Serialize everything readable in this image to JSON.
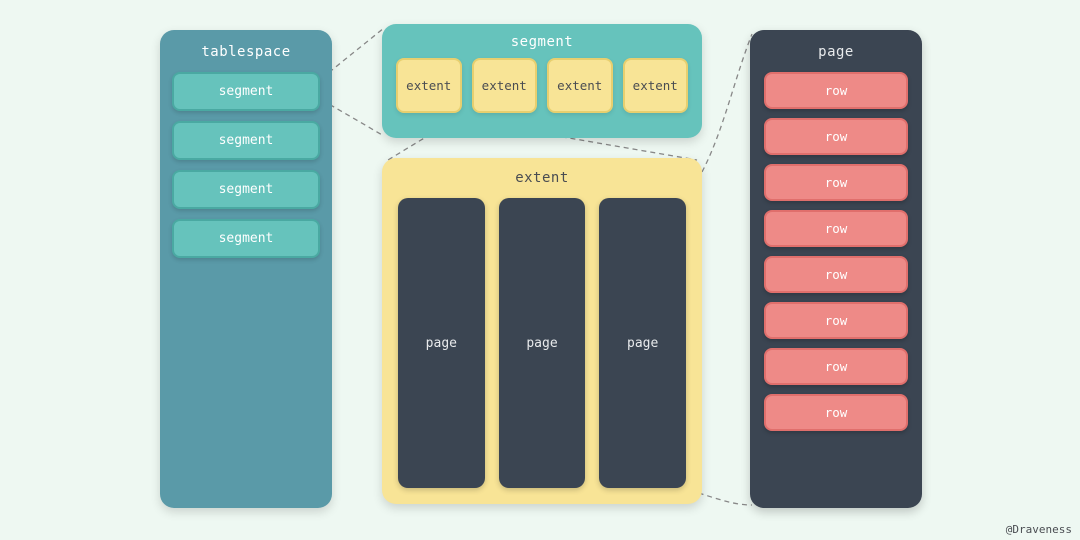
{
  "tablespace": {
    "title": "tablespace",
    "items": [
      "segment",
      "segment",
      "segment",
      "segment"
    ]
  },
  "segment": {
    "title": "segment",
    "items": [
      "extent",
      "extent",
      "extent",
      "extent"
    ]
  },
  "extent": {
    "title": "extent",
    "items": [
      "page",
      "page",
      "page"
    ]
  },
  "page": {
    "title": "page",
    "items": [
      "row",
      "row",
      "row",
      "row",
      "row",
      "row",
      "row",
      "row"
    ]
  },
  "attribution": "@Draveness",
  "colors": {
    "background": "#eef8f2",
    "tablespace_bg": "#5a9aa8",
    "segment_bg": "#66c3bc",
    "extent_bg": "#f8e496",
    "page_bg": "#3b4552",
    "row_bg": "#ee8a87"
  }
}
